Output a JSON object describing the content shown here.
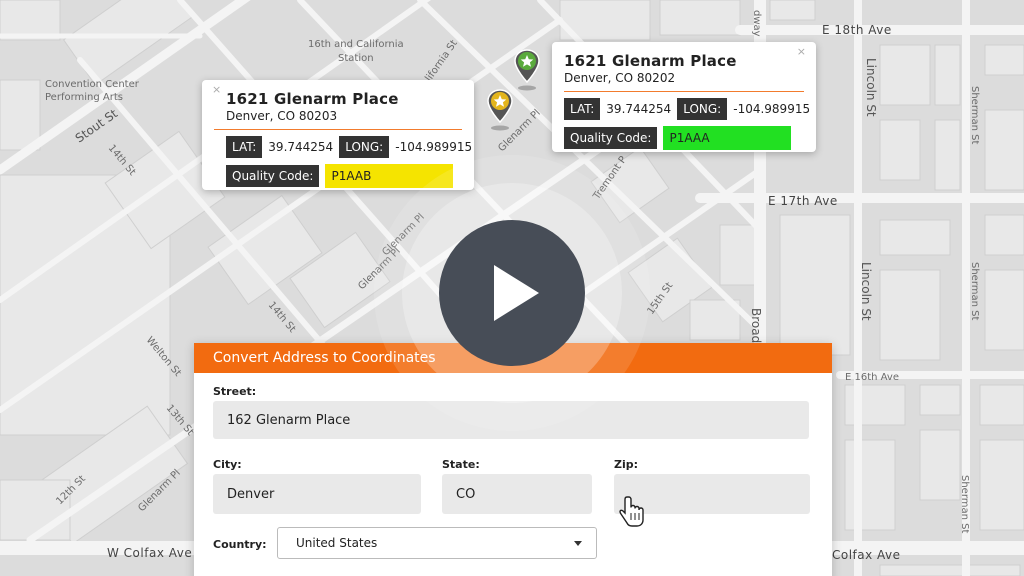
{
  "map": {
    "streets": {
      "e18th": "E 18th Ave",
      "e17th": "E 17th Ave",
      "e16th": "E 16th Ave",
      "colfax_left": "W Colfax Ave",
      "colfax_right": "Colfax Ave",
      "lincoln_top": "Lincoln St",
      "lincoln_mid": "Lincoln St",
      "sherman_top": "Sherman St",
      "sherman_mid": "Sherman St",
      "sherman_bot": "Sherman St",
      "broadway_top": "dway",
      "broadway_mid": "Broad",
      "stout": "Stout St",
      "fourteenth": "14th St",
      "fourteenth_b": "14th St",
      "thirteenth": "13th St",
      "twelfth": "12th St",
      "welton": "Welton St",
      "glenarm_pl_a": "Glenarm Pl",
      "glenarm_pl_b": "Glenarm Pl",
      "glenarm_pl_c": "Glenarm Pl",
      "glenarm_pl_d": "Glenarm Pl",
      "california": "lifornia St",
      "tremont": "Tremont P",
      "fifteenth": "15th St"
    },
    "places": {
      "station_line1": "16th and California",
      "station_line2": "Station",
      "convention_line1": "Convention Center",
      "convention_line2": "Performing Arts"
    }
  },
  "popup_left": {
    "close": "×",
    "title": "1621 Glenarm Place",
    "subtitle": "Denver, CO 80203",
    "lat_label": "LAT:",
    "lat": "39.744254",
    "long_label": "LONG:",
    "long": "-104.989915",
    "quality_label": "Quality Code:",
    "quality": "P1AAB",
    "quality_color": "#f5e400"
  },
  "popup_right": {
    "close": "×",
    "title": "1621 Glenarm Place",
    "subtitle": "Denver, CO 80202",
    "lat_label": "LAT:",
    "lat": "39.744254",
    "long_label": "LONG:",
    "long": "-104.989915",
    "quality_label": "Quality Code:",
    "quality": "P1AAA",
    "quality_color": "#22e022"
  },
  "pins": {
    "left_color": "#e3b51c",
    "right_color": "#5aaa3c",
    "icon": "star-icon"
  },
  "play": {
    "icon": "play-icon",
    "color": "#474d57"
  },
  "form": {
    "title": "Convert Address to Coordinates",
    "street_label": "Street:",
    "street_value": "162 Glenarm Place",
    "city_label": "City:",
    "city_value": "Denver",
    "state_label": "State:",
    "state_value": "CO",
    "zip_label": "Zip:",
    "zip_value": "",
    "country_label": "Country:",
    "country_value": "United States",
    "accent": "#f26b10"
  },
  "cursor": {
    "icon": "hand-pointer-icon"
  }
}
